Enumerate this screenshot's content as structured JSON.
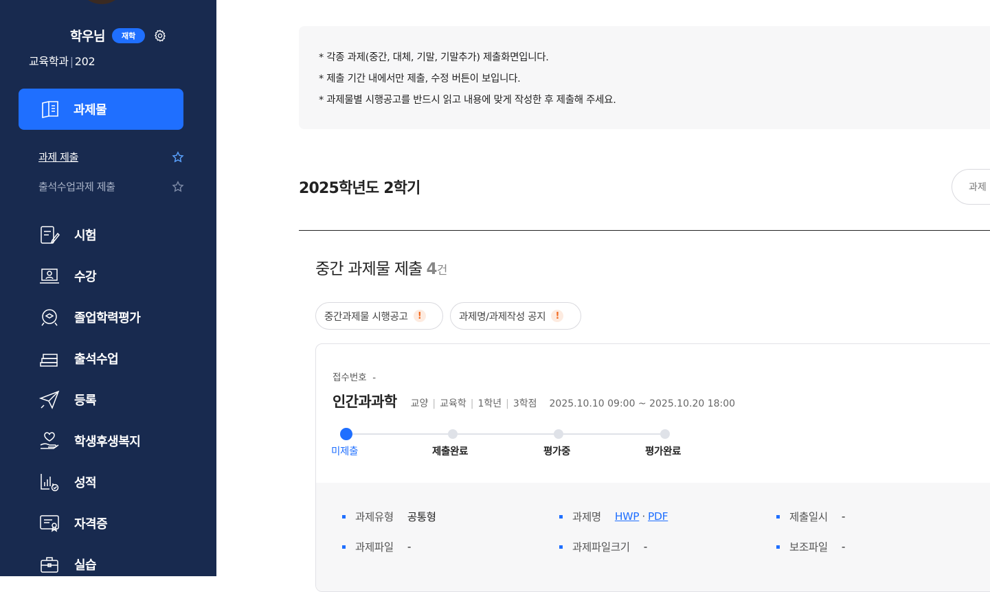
{
  "sidebar": {
    "user_name": "학우님",
    "status_badge": "재학",
    "department": "교육학과",
    "student_id": "202",
    "active_menu": "과제물",
    "submenu": [
      {
        "label": "과제 제출"
      },
      {
        "label": "출석수업과제 제출"
      }
    ],
    "menu": [
      {
        "label": "시험",
        "icon": "exam-icon"
      },
      {
        "label": "수강",
        "icon": "lecture-icon"
      },
      {
        "label": "졸업학력평가",
        "icon": "graduation-eval-icon"
      },
      {
        "label": "출석수업",
        "icon": "books-icon"
      },
      {
        "label": "등록",
        "icon": "paper-plane-icon"
      },
      {
        "label": "학생후생복지",
        "icon": "heart-hand-icon"
      },
      {
        "label": "성적",
        "icon": "grade-chart-icon"
      },
      {
        "label": "자격증",
        "icon": "certificate-icon"
      },
      {
        "label": "실습",
        "icon": "briefcase-icon"
      }
    ]
  },
  "notice": {
    "lines": [
      "* 각종 과제(중간, 대체, 기말, 기말추가) 제출화면입니다.",
      "* 제출 기간 내에서만 제출, 수정 버튼이 보입니다.",
      "* 과제물별 시행공고를 반드시 읽고 내용에 맞게 작성한 후 제출해 주세요."
    ]
  },
  "term": "2025학년도 2학기",
  "search_placeholder": "과제",
  "section": {
    "title": "중간 과제물 제출",
    "count": "4",
    "unit": "건",
    "pills": [
      "중간과제물 시행공고",
      "과제명/과제작성 공지"
    ],
    "pill_warn": "!"
  },
  "card": {
    "receipt_label": "접수번호",
    "receipt_value": "-",
    "course_name": "인간과과학",
    "meta": [
      "교양",
      "교육학",
      "1학년",
      "3학점"
    ],
    "period": "2025.10.10 09:00 ~ 2025.10.20 18:00",
    "steps": [
      "미제출",
      "제출완료",
      "평가중",
      "평가완료"
    ],
    "info": {
      "type_label": "과제유형",
      "type_value": "공통형",
      "name_label": "과제명",
      "hwp": "HWP",
      "name_sep": "·",
      "pdf": "PDF",
      "submit_label": "제출일시",
      "submit_value": "-",
      "file_label": "과제파일",
      "file_value": "-",
      "size_label": "과제파일크기",
      "size_value": "-",
      "aux_label": "보조파일",
      "aux_value": "-"
    }
  },
  "colors": {
    "sidebar_bg": "#182a4f",
    "accent": "#1f6fff",
    "warn": "#f36b21"
  }
}
